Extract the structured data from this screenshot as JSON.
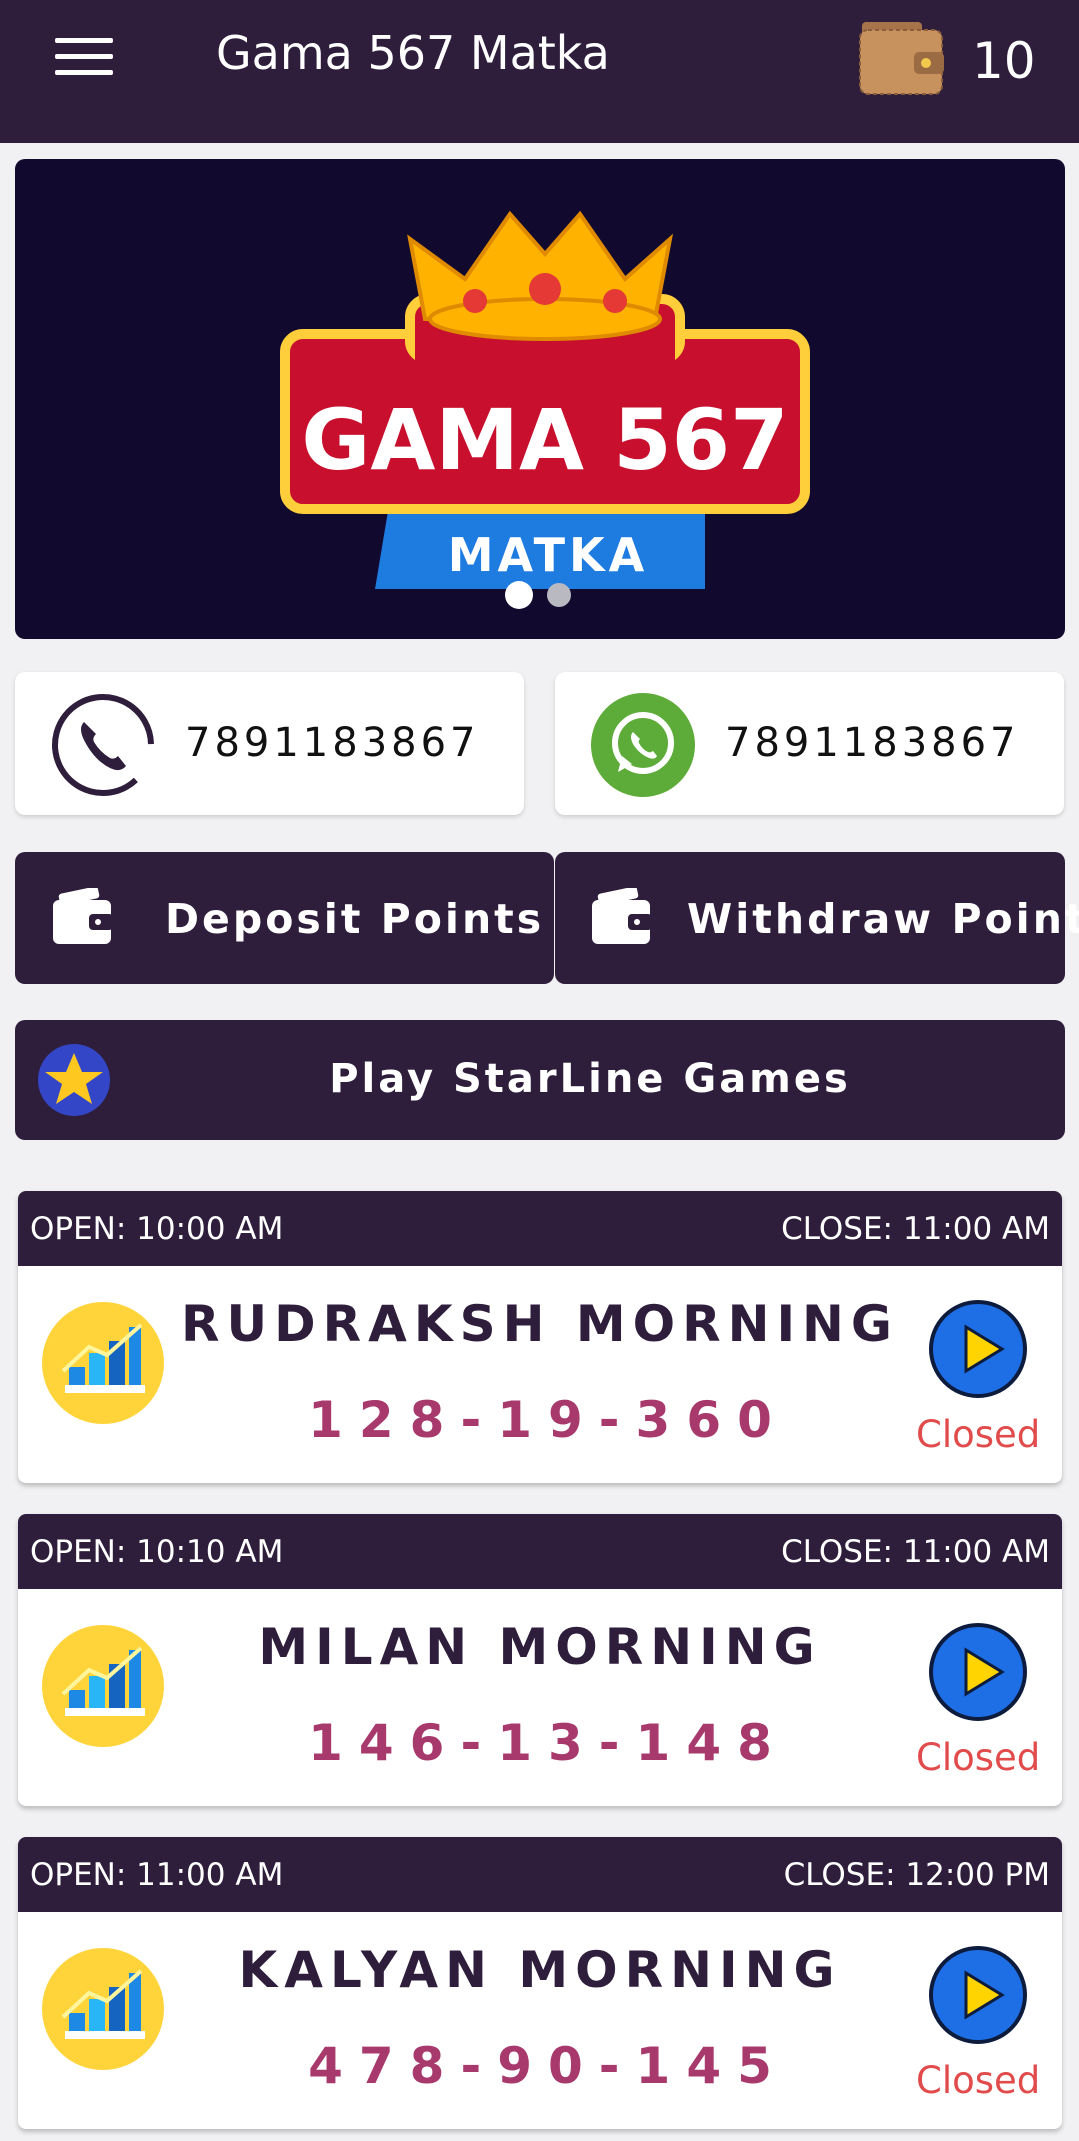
{
  "appbar": {
    "title": "Gama 567 Matka",
    "wallet_balance": "10",
    "menu_icon": "hamburger-icon",
    "wallet_icon": "wallet-icon"
  },
  "banner": {
    "logo_text": "GAMA 567",
    "logo_subtext": "MATKA",
    "slide_count": 2,
    "active_slide": 1
  },
  "contacts": {
    "phone": {
      "icon": "phone-icon",
      "number": "7891183867"
    },
    "whatsapp": {
      "icon": "whatsapp-icon",
      "number": "7891183867"
    }
  },
  "actions": {
    "deposit_label": "Deposit Points",
    "withdraw_label": "Withdraw Points",
    "starline_label": "Play StarLine Games"
  },
  "markets": [
    {
      "open": "OPEN: 10:00 AM",
      "close": "CLOSE: 11:00 AM",
      "name": "RUDRAKSH MORNING",
      "result": "128-19-360",
      "status": "Closed"
    },
    {
      "open": "OPEN: 10:10 AM",
      "close": "CLOSE: 11:00 AM",
      "name": "MILAN MORNING",
      "result": "146-13-148",
      "status": "Closed"
    },
    {
      "open": "OPEN: 11:00 AM",
      "close": "CLOSE: 12:00 PM",
      "name": "KALYAN MORNING",
      "result": "478-90-145",
      "status": "Closed"
    }
  ],
  "colors": {
    "primary": "#2e1e3c",
    "result": "#a8396c",
    "closed": "#e14b4b",
    "play": "#1e6fe6"
  }
}
